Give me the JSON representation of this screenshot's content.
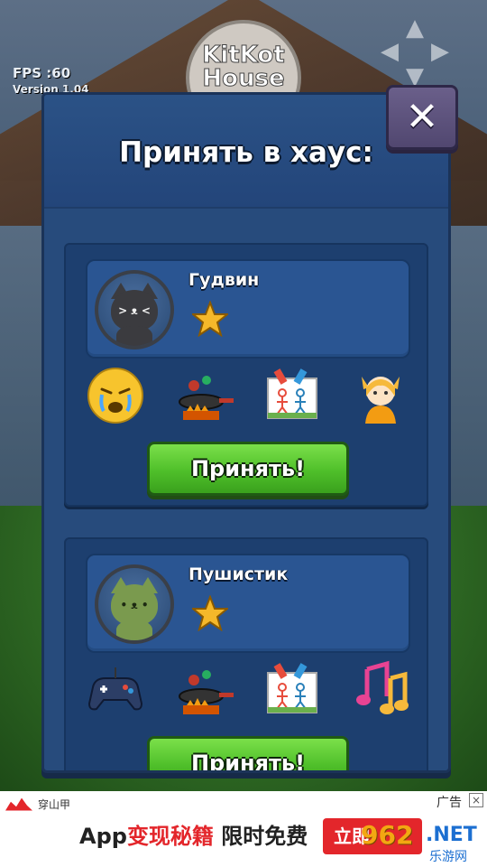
{
  "hud": {
    "fps": "FPS :60",
    "version": "Version 1.04"
  },
  "background": {
    "logo_text": "KitKot House"
  },
  "dialog": {
    "title": "Принять в хаус:",
    "close_icon": "close-x-icon",
    "cards": [
      {
        "name": "Гудвин",
        "avatar": "gray-cat-avatar",
        "face": "> ᴥ <",
        "stars": 1,
        "traits": [
          "crying-emoji-icon",
          "cooking-pan-icon",
          "drawing-icon",
          "cat-girl-icon"
        ],
        "accept_label": "Принять!"
      },
      {
        "name": "Пушистик",
        "avatar": "green-cat-avatar",
        "face": "• ᴥ •",
        "stars": 1,
        "traits": [
          "gamepad-icon",
          "cooking-pan-icon",
          "drawing-icon",
          "music-notes-icon"
        ],
        "accept_label": "Принять!"
      }
    ]
  },
  "ad": {
    "brand": "穿山甲",
    "tag": "广告",
    "close": "×",
    "headline_prefix": "App",
    "headline_red": "变现秘籍",
    "headline_suffix": " 限时免费",
    "cta": "立即",
    "watermark_num": "962",
    "watermark_net": ".NET",
    "watermark_site": "乐游网"
  },
  "colors": {
    "panel": "#274b7c",
    "card": "#1d3f6f",
    "accept": "#4fbf2a",
    "close": "#5d537e",
    "ad_red": "#e3262b"
  }
}
